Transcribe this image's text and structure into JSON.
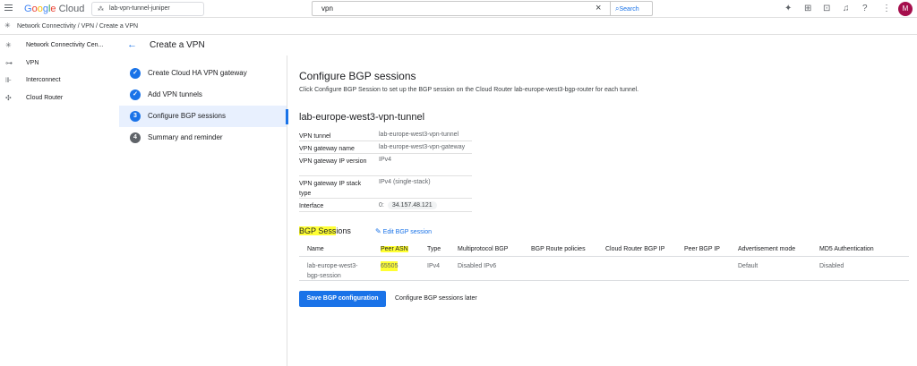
{
  "header": {
    "logo_text": "Google Cloud",
    "logo_letters": [
      "G",
      "o",
      "o",
      "g",
      "l",
      "e"
    ],
    "logo_cloud": "Cloud",
    "project": "lab-vpn-tunnel-juniper",
    "search_value": "vpn",
    "search_button": "Search",
    "avatar_letter": "M",
    "icons": [
      "menu-icon",
      "project-icon",
      "search-icon",
      "gemini-icon",
      "gift-icon",
      "terminal-icon",
      "notifications-icon",
      "help-icon",
      "more-vert-icon"
    ]
  },
  "breadcrumb": {
    "items": [
      "Network Connectivity",
      "VPN",
      "Create a VPN"
    ],
    "separator": "/"
  },
  "sidebar": {
    "items": [
      {
        "label": "Network Connectivity Cen...",
        "icon": "network-connectivity-icon"
      },
      {
        "label": "VPN",
        "icon": "vpn-icon"
      },
      {
        "label": "Interconnect",
        "icon": "interconnect-icon"
      },
      {
        "label": "Cloud Router",
        "icon": "cloud-router-icon"
      }
    ]
  },
  "page": {
    "title": "Create a VPN"
  },
  "steps": [
    {
      "label": "Create Cloud HA VPN gateway",
      "state": "done",
      "marker": "✓"
    },
    {
      "label": "Add VPN tunnels",
      "state": "done",
      "marker": "✓"
    },
    {
      "label": "Configure BGP sessions",
      "state": "current",
      "marker": "3"
    },
    {
      "label": "Summary and reminder",
      "state": "todo",
      "marker": "4"
    }
  ],
  "main": {
    "heading": "Configure BGP sessions",
    "description": "Click Configure BGP Session to set up the BGP session on the Cloud Router lab-europe-west3-bgp-router for each tunnel.",
    "tunnel_name": "lab-europe-west3-vpn-tunnel",
    "details": [
      {
        "key": "VPN tunnel",
        "value": "lab-europe-west3-vpn-tunnel"
      },
      {
        "key": "VPN gateway name",
        "value": "lab-europe-west3-vpn-gateway"
      },
      {
        "key": "VPN gateway IP version",
        "value": "IPv4"
      },
      {
        "key": "VPN gateway IP stack type",
        "value": "IPv4 (single-stack)"
      },
      {
        "key": "Interface",
        "value": "0:",
        "chip": "34.157.48.121"
      }
    ],
    "bgp_heading_highlight": "BGP Sess",
    "bgp_heading_rest": "ions",
    "edit_link": "Edit BGP session",
    "table": {
      "headers": [
        "Name",
        "Peer ASN",
        "Type",
        "Multiprotocol BGP",
        "BGP Route policies",
        "Cloud Router BGP IP",
        "Peer BGP IP",
        "Advertisement mode",
        "MD5 Authentication"
      ],
      "row": {
        "name_line1": "lab-europe-west3-",
        "name_line2": "bgp-session",
        "peer_asn": "65505",
        "type": "IPv4",
        "multiprotocol": "Disabled IPv6",
        "route_policies": "",
        "router_ip": "",
        "peer_ip": "",
        "advertisement": "Default",
        "md5": "Disabled"
      }
    },
    "save_button": "Save BGP configuration",
    "later_button": "Configure BGP sessions later"
  },
  "colors": {
    "accent": "#1a73e8",
    "highlight": "#ffff33",
    "avatar": "#a50e4c"
  }
}
